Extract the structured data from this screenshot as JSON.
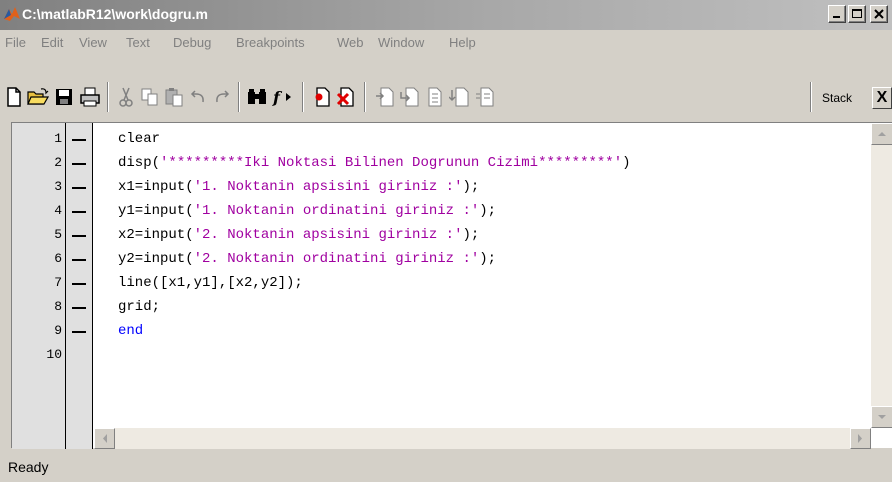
{
  "window": {
    "title": "C:\\matlabR12\\work\\dogru.m"
  },
  "menu": [
    "File",
    "Edit",
    "View",
    "Text",
    "Debug",
    "Breakpoints",
    "Web",
    "Window",
    "Help"
  ],
  "toolbar": {
    "stack_label": "Stack",
    "stack_close": "X"
  },
  "editor": {
    "line_numbers": [
      "1",
      "2",
      "3",
      "4",
      "5",
      "6",
      "7",
      "8",
      "9",
      "10"
    ],
    "lines": [
      {
        "code": "clear",
        "string": "",
        "tail": "",
        "keyword": ""
      },
      {
        "code": "disp(",
        "string": "'*********Iki Noktasi Bilinen Dogrunun Cizimi*********'",
        "tail": ")",
        "keyword": ""
      },
      {
        "code": "x1=input(",
        "string": "'1. Noktanin apsisini giriniz :'",
        "tail": ");",
        "keyword": ""
      },
      {
        "code": "y1=input(",
        "string": "'1. Noktanin ordinatini giriniz :'",
        "tail": ");",
        "keyword": ""
      },
      {
        "code": "x2=input(",
        "string": "'2. Noktanin apsisini giriniz :'",
        "tail": ");",
        "keyword": ""
      },
      {
        "code": "y2=input(",
        "string": "'2. Noktanin ordinatini giriniz :'",
        "tail": ");",
        "keyword": ""
      },
      {
        "code": "line([x1,y1],[x2,y2]);",
        "string": "",
        "tail": "",
        "keyword": ""
      },
      {
        "code": "grid;",
        "string": "",
        "tail": "",
        "keyword": ""
      },
      {
        "code": "",
        "string": "",
        "tail": "",
        "keyword": "end"
      }
    ]
  },
  "status": {
    "text": "Ready"
  },
  "colors": {
    "string": "#a000a0",
    "keyword": "#0000ff",
    "title_gradient_start": "#808080",
    "chrome": "#d4d0c8"
  },
  "icons": [
    "matlab-logo-icon",
    "new-file-icon",
    "open-folder-icon",
    "save-icon",
    "print-icon",
    "cut-icon",
    "copy-icon",
    "paste-icon",
    "undo-icon",
    "redo-icon",
    "find-icon",
    "function-icon",
    "set-breakpoint-icon",
    "clear-breakpoints-icon",
    "step-icon",
    "step-in-icon",
    "step-out-icon",
    "continue-icon",
    "exit-debug-icon"
  ]
}
